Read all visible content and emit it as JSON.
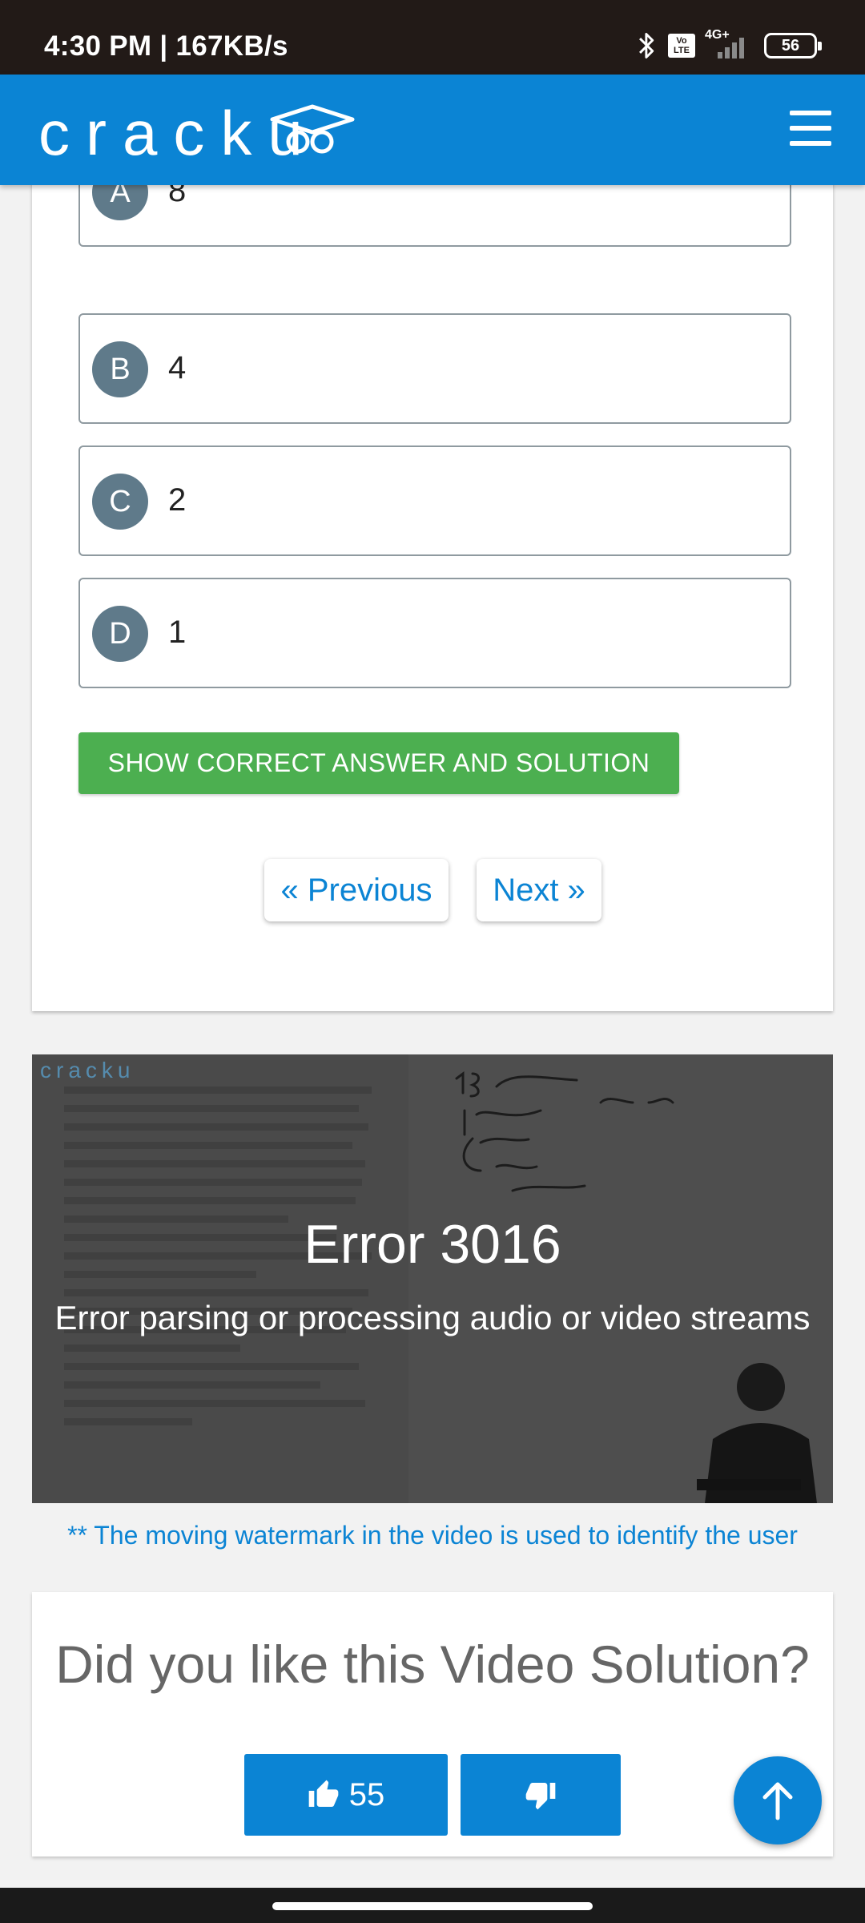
{
  "status_bar": {
    "time_speed": "4:30 PM | 167KB/s",
    "volte": "Vo LTE",
    "network": "4G+",
    "battery": "56"
  },
  "header": {
    "logo": "cracku"
  },
  "question": {
    "options": [
      {
        "letter": "A",
        "text": "8"
      },
      {
        "letter": "B",
        "text": "4"
      },
      {
        "letter": "C",
        "text": "2"
      },
      {
        "letter": "D",
        "text": "1"
      }
    ],
    "show_solution_label": "SHOW CORRECT ANSWER AND SOLUTION",
    "previous_label": "« Previous",
    "next_label": "Next »"
  },
  "video": {
    "logo": "cracku",
    "error_title": "Error 3016",
    "error_message": "Error parsing or processing audio or video streams"
  },
  "watermark_note": "** The moving watermark in the video is used to identify the user",
  "rating": {
    "question": "Did you like this Video Solution?",
    "likes": "55"
  },
  "colors": {
    "brand_blue": "#0b84d4",
    "success_green": "#4caf50",
    "option_circle": "#5f7a8a"
  }
}
